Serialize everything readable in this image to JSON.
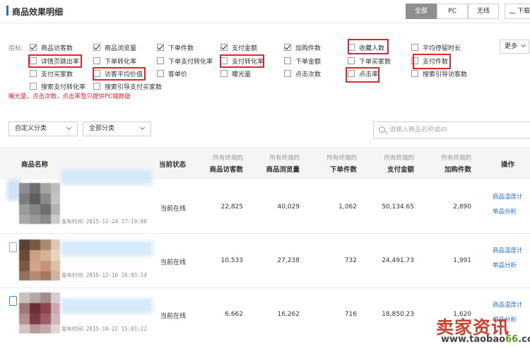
{
  "header": {
    "title": "商品效果明细",
    "segments": [
      "全部",
      "PC",
      "无线"
    ],
    "download_label": "下载",
    "accent": "#2b6cc4"
  },
  "indicators": {
    "label": "指标:",
    "items": [
      {
        "label": "商品访客数",
        "checked": true
      },
      {
        "label": "商品浏览量",
        "checked": true
      },
      {
        "label": "下单件数",
        "checked": true
      },
      {
        "label": "支付金额",
        "checked": true
      },
      {
        "label": "加购件数",
        "checked": true
      },
      {
        "label": "收藏人数",
        "checked": false
      },
      {
        "label": "平均停留时长",
        "checked": false
      },
      {
        "label": "详情页跳出率",
        "checked": false
      },
      {
        "label": "下单转化率",
        "checked": false
      },
      {
        "label": "下单支付转化率",
        "checked": false
      },
      {
        "label": "支付转化率",
        "checked": false
      },
      {
        "label": "下单金额",
        "checked": false
      },
      {
        "label": "下单买家数",
        "checked": false
      },
      {
        "label": "支付件数",
        "checked": false
      },
      {
        "label": "支付买家数",
        "checked": false
      },
      {
        "label": "访客平均价值",
        "checked": false
      },
      {
        "label": "客单价",
        "checked": false
      },
      {
        "label": "曝光量",
        "checked": false
      },
      {
        "label": "点击次数",
        "checked": false
      },
      {
        "label": "点击率",
        "checked": false
      },
      {
        "label": "搜索引导访客数",
        "checked": false
      },
      {
        "label": "搜索支付转化率",
        "checked": false
      },
      {
        "label": "搜索引导支付买家数",
        "checked": false
      }
    ],
    "more_label": "更多",
    "note": "曝光量，点击次数，点击率暂只提供PC端数据",
    "highlight_color": "#e0262c"
  },
  "filters": {
    "custom_category": "自定义分类",
    "all_category": "全部分类",
    "search_placeholder": "请输入商品名称或ID"
  },
  "table": {
    "headers": {
      "name": "商品名称",
      "status": "当前状态",
      "metric_prefix": "所有终端的",
      "metrics": [
        "商品访客数",
        "商品浏览量",
        "下单件数",
        "支付金额",
        "加购件数"
      ],
      "op": "操作"
    },
    "rows": [
      {
        "publish_label": "发布时间:",
        "publish_time": "2015-11-24 17:19:08",
        "status": "当前在线",
        "values": [
          "22,825",
          "40,029",
          "1,062",
          "50,134.65",
          "2,890"
        ]
      },
      {
        "publish_label": "发布时间:",
        "publish_time": "2015-12-10 16:03:14",
        "status": "当前在线",
        "values": [
          "10,533",
          "27,238",
          "732",
          "24,491.73",
          "1,991"
        ]
      },
      {
        "publish_label": "发布时间:",
        "publish_time": "2015-10-22 15:01:22",
        "status": "当前在线",
        "values": [
          "6,662",
          "16,262",
          "716",
          "18,850.23",
          "1,620"
        ]
      }
    ],
    "ops": [
      "商品温度计",
      "单品分析"
    ]
  },
  "watermark": {
    "text": "卖家资讯",
    "url_prefix": "www.",
    "url_mid": "taobao",
    "url_num": "66",
    "url_suffix": ".com"
  }
}
